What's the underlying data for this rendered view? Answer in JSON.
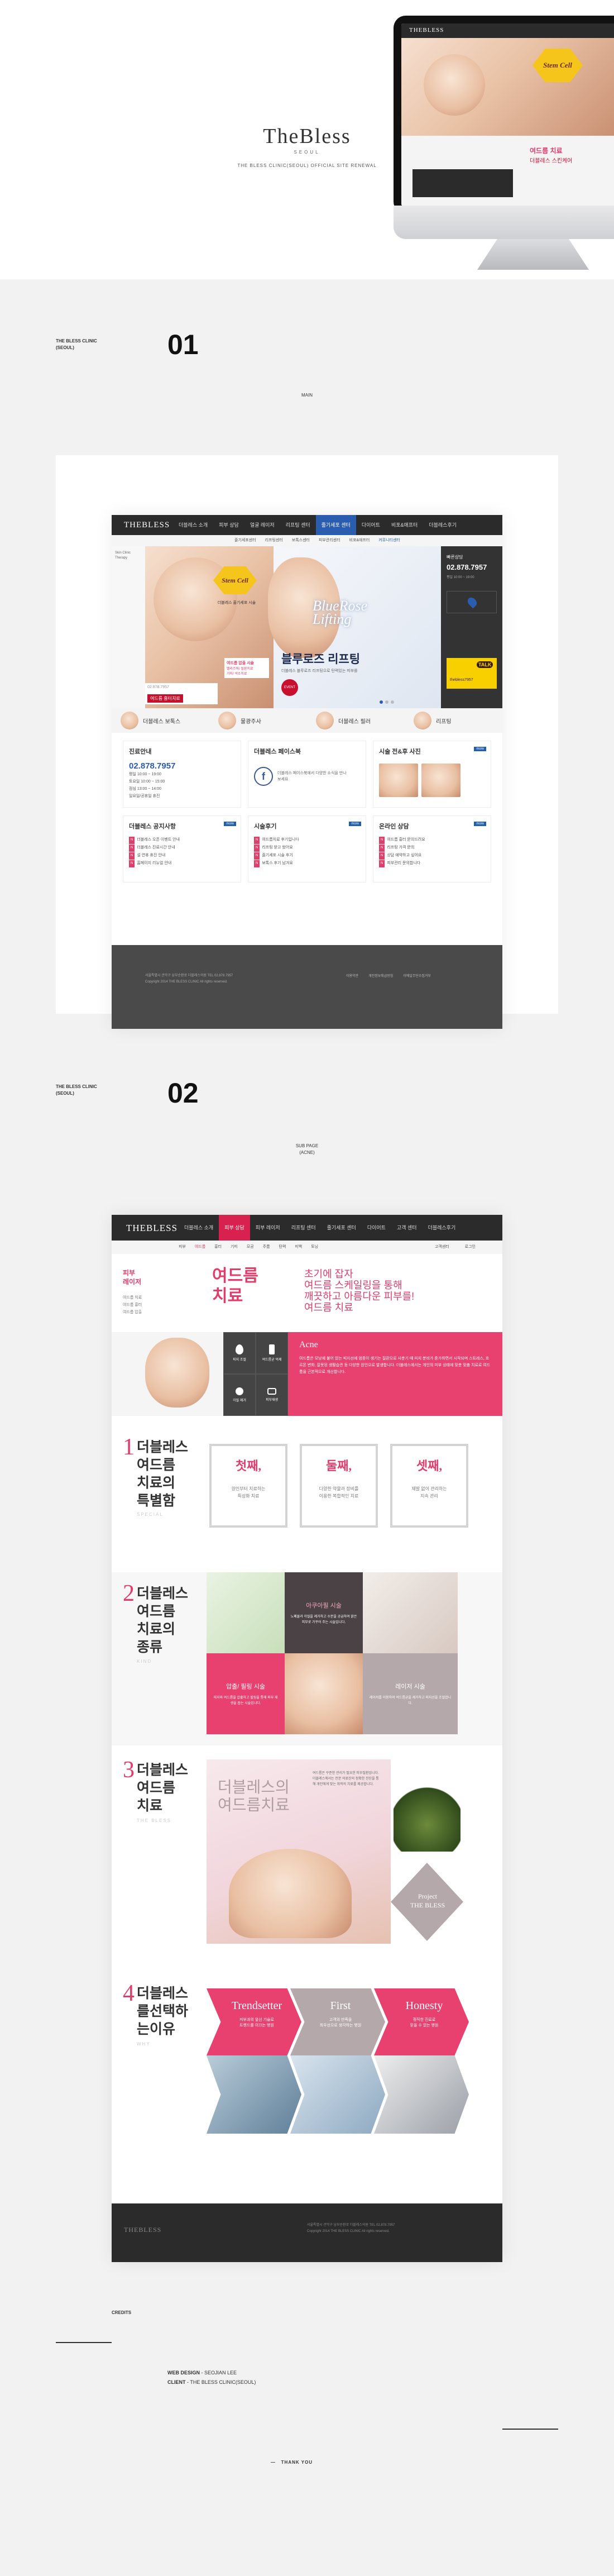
{
  "hero": {
    "logo": "TheBless",
    "logo_sub": "SEOUL",
    "tagline": "THE BLESS CLINIC(SEOUL) OFFICIAL SITE RENEWAL",
    "monitor_site": {
      "logo": "THEBLESS",
      "badge": "Stem Cell",
      "promo_lines": [
        "여드름 치료",
        "더블레스 스킨케어"
      ]
    }
  },
  "section1": {
    "side_label": [
      "THE BLESS CLINIC",
      "(SEOUL)"
    ],
    "number": "01",
    "label": "MAIN"
  },
  "main_site": {
    "logo": "THEBLESS",
    "nav": [
      "더블레스 소개",
      "피부 상담",
      "얼굴 레이저",
      "리프팅 센터",
      "줄기세포 센터",
      "다이어트",
      "비포&애프터",
      "더블레스후기"
    ],
    "active_nav_index": 4,
    "blue_nav_index": 4,
    "subnav": [
      "줄기세포센터",
      "리프팅센터",
      "보톡스센터",
      "피부관리센터",
      "비포&애프터",
      "커뮤니티센터"
    ],
    "left_box_text": "Skin Clinic Therapy",
    "stem_cell_badge": "Stem Cell",
    "stem_cell_caption": "더블레스 줄기세포 시술",
    "promo_pink": [
      "여드름 압출 시술",
      "멜라즈마/ 질환치료",
      "기미/ 색소치료"
    ],
    "promo_red": "여드름 흉터치료",
    "promo_small": "02.878.7957",
    "blue_rose_title": "BlueRose Lifting",
    "blue_rose_heading": "블루로즈 리프팅",
    "blue_rose_body": "더블레스 블루로즈 리프팅으로 탄력있는 피부를",
    "event_badge": "EVENT",
    "right_panel": {
      "title": "빠른상담",
      "phone": "02.878.7957",
      "kakao": "TALK",
      "kakao_id": "thebless7957",
      "hours": "평일 10:00 ~ 19:00"
    },
    "quick_links": [
      "더블레스 보톡스",
      "물광주사",
      "더블레스 필러",
      "리프팅"
    ],
    "panels_row1": [
      {
        "title": "진료안내",
        "phone": "02.878.7957",
        "lines": [
          "평일 10:00 ~ 19:00",
          "토요일 10:00 ~ 15:00",
          "점심 13:00 ~ 14:00",
          "일요일/공휴일 휴진"
        ]
      },
      {
        "title": "더블레스 페이스북",
        "facebook_text": "더블레스 페이스북에서 다양한 소식을 만나보세요"
      },
      {
        "title": "시술 전&후 사진",
        "more": "more"
      }
    ],
    "panels_row2": [
      {
        "title": "더블레스 공지사항",
        "more": "more",
        "items": [
          "더블레스 오픈 이벤트 안내",
          "더블레스 진료시간 안내",
          "설 연휴 휴진 안내",
          "홈페이지 리뉴얼 안내"
        ]
      },
      {
        "title": "시술후기",
        "more": "more",
        "items": [
          "여드름치료 후기입니다",
          "리프팅 받고 왔어요",
          "줄기세포 시술 후기",
          "보톡스 후기 남겨요"
        ]
      },
      {
        "title": "온라인 상담",
        "more": "more",
        "items": [
          "여드름 흉터 문의드려요",
          "리프팅 가격 문의",
          "상담 예약하고 싶어요",
          "피부관리 문의합니다"
        ]
      }
    ],
    "footer_lines": [
      "서울특별시 관악구 남부순환로 더블레스의원 TEL 02.878.7957",
      "Copyright 2014 THE BLESS CLINIC All rights reserved."
    ],
    "footer_links": [
      "이용약관",
      "개인정보취급방침",
      "이메일무단수집거부"
    ]
  },
  "section2": {
    "side_label": [
      "THE BLESS CLINIC",
      "(SEOUL)"
    ],
    "number": "02",
    "label": [
      "SUB PAGE",
      "(ACNE)"
    ]
  },
  "sub_site": {
    "logo": "THEBLESS",
    "nav": [
      "더블레스 소개",
      "피부 상담",
      "피부 레이저",
      "리프팅 센터",
      "줄기세포 센터",
      "다이어트",
      "고객 센터",
      "더블레스후기"
    ],
    "active_nav_index": 1,
    "subnav": [
      "피부",
      "여드름",
      "흉터",
      "기미",
      "모공",
      "주름",
      "탄력",
      "미백",
      "토닝"
    ],
    "subnav_right": [
      "고객센터",
      "로그인"
    ],
    "left_menu_title": [
      "피부",
      "레이저"
    ],
    "left_menu_items": [
      "여드름 치료",
      "여드름 흉터",
      "여드름 압출"
    ],
    "page_title": [
      "여드름",
      "치료"
    ],
    "intro": [
      "초기에 잡자",
      "여드름 스케일링을 통해",
      "깨끗하고 아름다운 피부를!",
      "여드름 치료"
    ],
    "icons": [
      {
        "name": "water-drop-icon",
        "label": "피지 조절"
      },
      {
        "name": "bottle-icon",
        "label": "여드름균 억제"
      },
      {
        "name": "drop-icon",
        "label": "각질 제거"
      },
      {
        "name": "skin-icon",
        "label": "피부재생"
      }
    ],
    "acne_box_title": "Acne",
    "acne_box_text": "여드름은 모낭에 붙어 있는 피지선에 염증이 생기는 질환으로 사춘기 때 피지 분비가 증가하면서 시작되며 스트레스, 호르몬 변화, 잘못된 생활습관 등 다양한 원인으로 발생합니다. 더블레스에서는 개인의 피부 상태에 맞춘 맞춤 치료로 여드름을 근본적으로 개선합니다.",
    "step1": {
      "num": "1",
      "title": [
        "더블레스",
        "여드름",
        "치료의",
        "특별함"
      ],
      "caption": "SPECIAL",
      "items": [
        {
          "word": "첫째,",
          "text": [
            "원인부터 치료하는",
            "특성화 치료"
          ]
        },
        {
          "word": "둘째,",
          "text": [
            "다양한 약물과 장비를",
            "이용한 복합적인 치료"
          ]
        },
        {
          "word": "셋째,",
          "text": [
            "재발 없이 관리하는",
            "지속 관리"
          ]
        }
      ]
    },
    "step2": {
      "num": "2",
      "title": [
        "더블레스",
        "여드름",
        "치료의",
        "종류"
      ],
      "caption": "KIND",
      "tile_a_title": "아쿠아필 시술",
      "tile_a_text": "노폐물과 각질을 제거하고 수분을 공급하여 맑은 피부로 가꾸어 주는 시술입니다.",
      "tile_b_title": "압출/ 필링 시술",
      "tile_b_text": "피지와 여드름을 압출하고 필링을 통해 피부 재생을 돕는 시술입니다.",
      "tile_c_title": "레이저 시술",
      "tile_c_text": "레이저를 이용하여 여드름균을 제거하고 피지선을 조절합니다."
    },
    "step3": {
      "num": "3",
      "title": [
        "더블레스",
        "여드름",
        "치료"
      ],
      "caption": "THE BLESS",
      "big_text": [
        "더블레스의",
        "여드름치료"
      ],
      "side_text": "여드름은 꾸준한 관리가 필요한 피부질환입니다. 더블레스에서는 전문 의료진의 정확한 진단을 통해 개인에게 맞는 최적의 치료를 제공합니다.",
      "watermark": [
        "Project",
        "THE BLESS"
      ]
    },
    "step4": {
      "num": "4",
      "title": [
        "더블레스",
        "를선택하",
        "는이유"
      ],
      "caption": "WHY",
      "arrows": [
        {
          "title": "Trendsetter",
          "text": [
            "피부과의 앞선 기술로",
            "트렌드를 이끄는 병원"
          ]
        },
        {
          "title": "First",
          "text": [
            "고객의 만족을",
            "최우선으로 생각하는 병원"
          ]
        },
        {
          "title": "Honesty",
          "text": [
            "정직한 진료로",
            "믿을 수 있는 병원"
          ]
        }
      ]
    },
    "footer_logo": "THEBLESS",
    "footer_lines": [
      "서울특별시 관악구 남부순환로 더블레스의원 TEL 02.878.7957",
      "Copyright 2014 THE BLESS CLINIC All rights reserved."
    ]
  },
  "credits": {
    "title": "CREDITS",
    "web_design_label": "WEB DESIGN",
    "web_design_value": "SEOJIAN LEE",
    "client_label": "CLIENT",
    "client_value": "THE BLESS CLINIC(SEOUL)",
    "thank_you": "THANK YOU"
  }
}
